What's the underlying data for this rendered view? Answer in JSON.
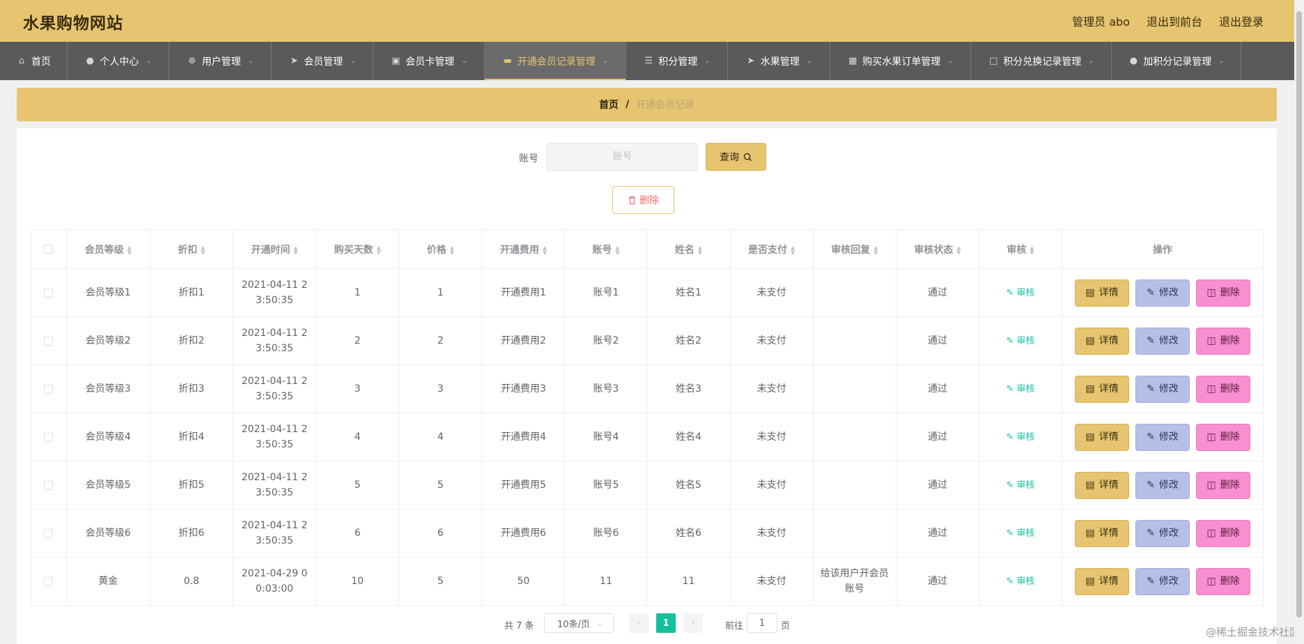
{
  "header": {
    "brand": "水果购物网站",
    "admin": "管理员 abo",
    "to_front": "退出到前台",
    "logout": "退出登录"
  },
  "nav": [
    {
      "label": "首页",
      "icon": "home-icon",
      "dropdown": false
    },
    {
      "label": "个人中心",
      "icon": "user-icon",
      "dropdown": true
    },
    {
      "label": "用户管理",
      "icon": "target-icon",
      "dropdown": true
    },
    {
      "label": "会员管理",
      "icon": "send-icon",
      "dropdown": true
    },
    {
      "label": "会员卡管理",
      "icon": "monitor-icon",
      "dropdown": true
    },
    {
      "label": "开通会员记录管理",
      "icon": "ticket-icon",
      "dropdown": true,
      "active": true
    },
    {
      "label": "积分管理",
      "icon": "list-icon",
      "dropdown": true
    },
    {
      "label": "水果管理",
      "icon": "navigation-icon",
      "dropdown": true
    },
    {
      "label": "购买水果订单管理",
      "icon": "chart-icon",
      "dropdown": true
    },
    {
      "label": "积分兑换记录管理",
      "icon": "crop-icon",
      "dropdown": true
    },
    {
      "label": "加积分记录管理",
      "icon": "person-icon",
      "dropdown": true
    }
  ],
  "breadcrumb": {
    "home": "首页",
    "sep": "/",
    "current": "开通会员记录"
  },
  "search": {
    "label": "账号",
    "placeholder": "账号",
    "button": "查询"
  },
  "batch_delete": "删除",
  "table": {
    "columns": [
      "会员等级",
      "折扣",
      "开通时间",
      "购买天数",
      "价格",
      "开通费用",
      "账号",
      "姓名",
      "是否支付",
      "审核回复",
      "审核状态",
      "审核",
      "操作"
    ],
    "audit_label": "审核",
    "ops": {
      "detail": "详情",
      "edit": "修改",
      "delete": "删除"
    },
    "rows": [
      {
        "level": "会员等级1",
        "discount": "折扣1",
        "time": "2021-04-11 23:50:35",
        "days": "1",
        "price": "1",
        "fee": "开通费用1",
        "account": "账号1",
        "name": "姓名1",
        "paid": "未支付",
        "reply": "",
        "status": "通过"
      },
      {
        "level": "会员等级2",
        "discount": "折扣2",
        "time": "2021-04-11 23:50:35",
        "days": "2",
        "price": "2",
        "fee": "开通费用2",
        "account": "账号2",
        "name": "姓名2",
        "paid": "未支付",
        "reply": "",
        "status": "通过"
      },
      {
        "level": "会员等级3",
        "discount": "折扣3",
        "time": "2021-04-11 23:50:35",
        "days": "3",
        "price": "3",
        "fee": "开通费用3",
        "account": "账号3",
        "name": "姓名3",
        "paid": "未支付",
        "reply": "",
        "status": "通过"
      },
      {
        "level": "会员等级4",
        "discount": "折扣4",
        "time": "2021-04-11 23:50:35",
        "days": "4",
        "price": "4",
        "fee": "开通费用4",
        "account": "账号4",
        "name": "姓名4",
        "paid": "未支付",
        "reply": "",
        "status": "通过"
      },
      {
        "level": "会员等级5",
        "discount": "折扣5",
        "time": "2021-04-11 23:50:35",
        "days": "5",
        "price": "5",
        "fee": "开通费用5",
        "account": "账号5",
        "name": "姓名5",
        "paid": "未支付",
        "reply": "",
        "status": "通过"
      },
      {
        "level": "会员等级6",
        "discount": "折扣6",
        "time": "2021-04-11 23:50:35",
        "days": "6",
        "price": "6",
        "fee": "开通费用6",
        "account": "账号6",
        "name": "姓名6",
        "paid": "未支付",
        "reply": "",
        "status": "通过"
      },
      {
        "level": "黄金",
        "discount": "0.8",
        "time": "2021-04-29 00:03:00",
        "days": "10",
        "price": "5",
        "fee": "50",
        "account": "11",
        "name": "11",
        "paid": "未支付",
        "reply": "给该用户开会员账号",
        "status": "通过"
      }
    ]
  },
  "pagination": {
    "total": "共 7 条",
    "page_size": "10条/页",
    "current": "1",
    "goto": "前往",
    "goto_value": "1",
    "page_suffix": "页"
  },
  "watermark": "@稀土掘金技术社区",
  "colors": {
    "accent": "#e6c470",
    "nav_bg": "#5a5a5a",
    "success": "#13c09c",
    "edit": "#b8bfe6",
    "danger": "#f78fd1"
  }
}
